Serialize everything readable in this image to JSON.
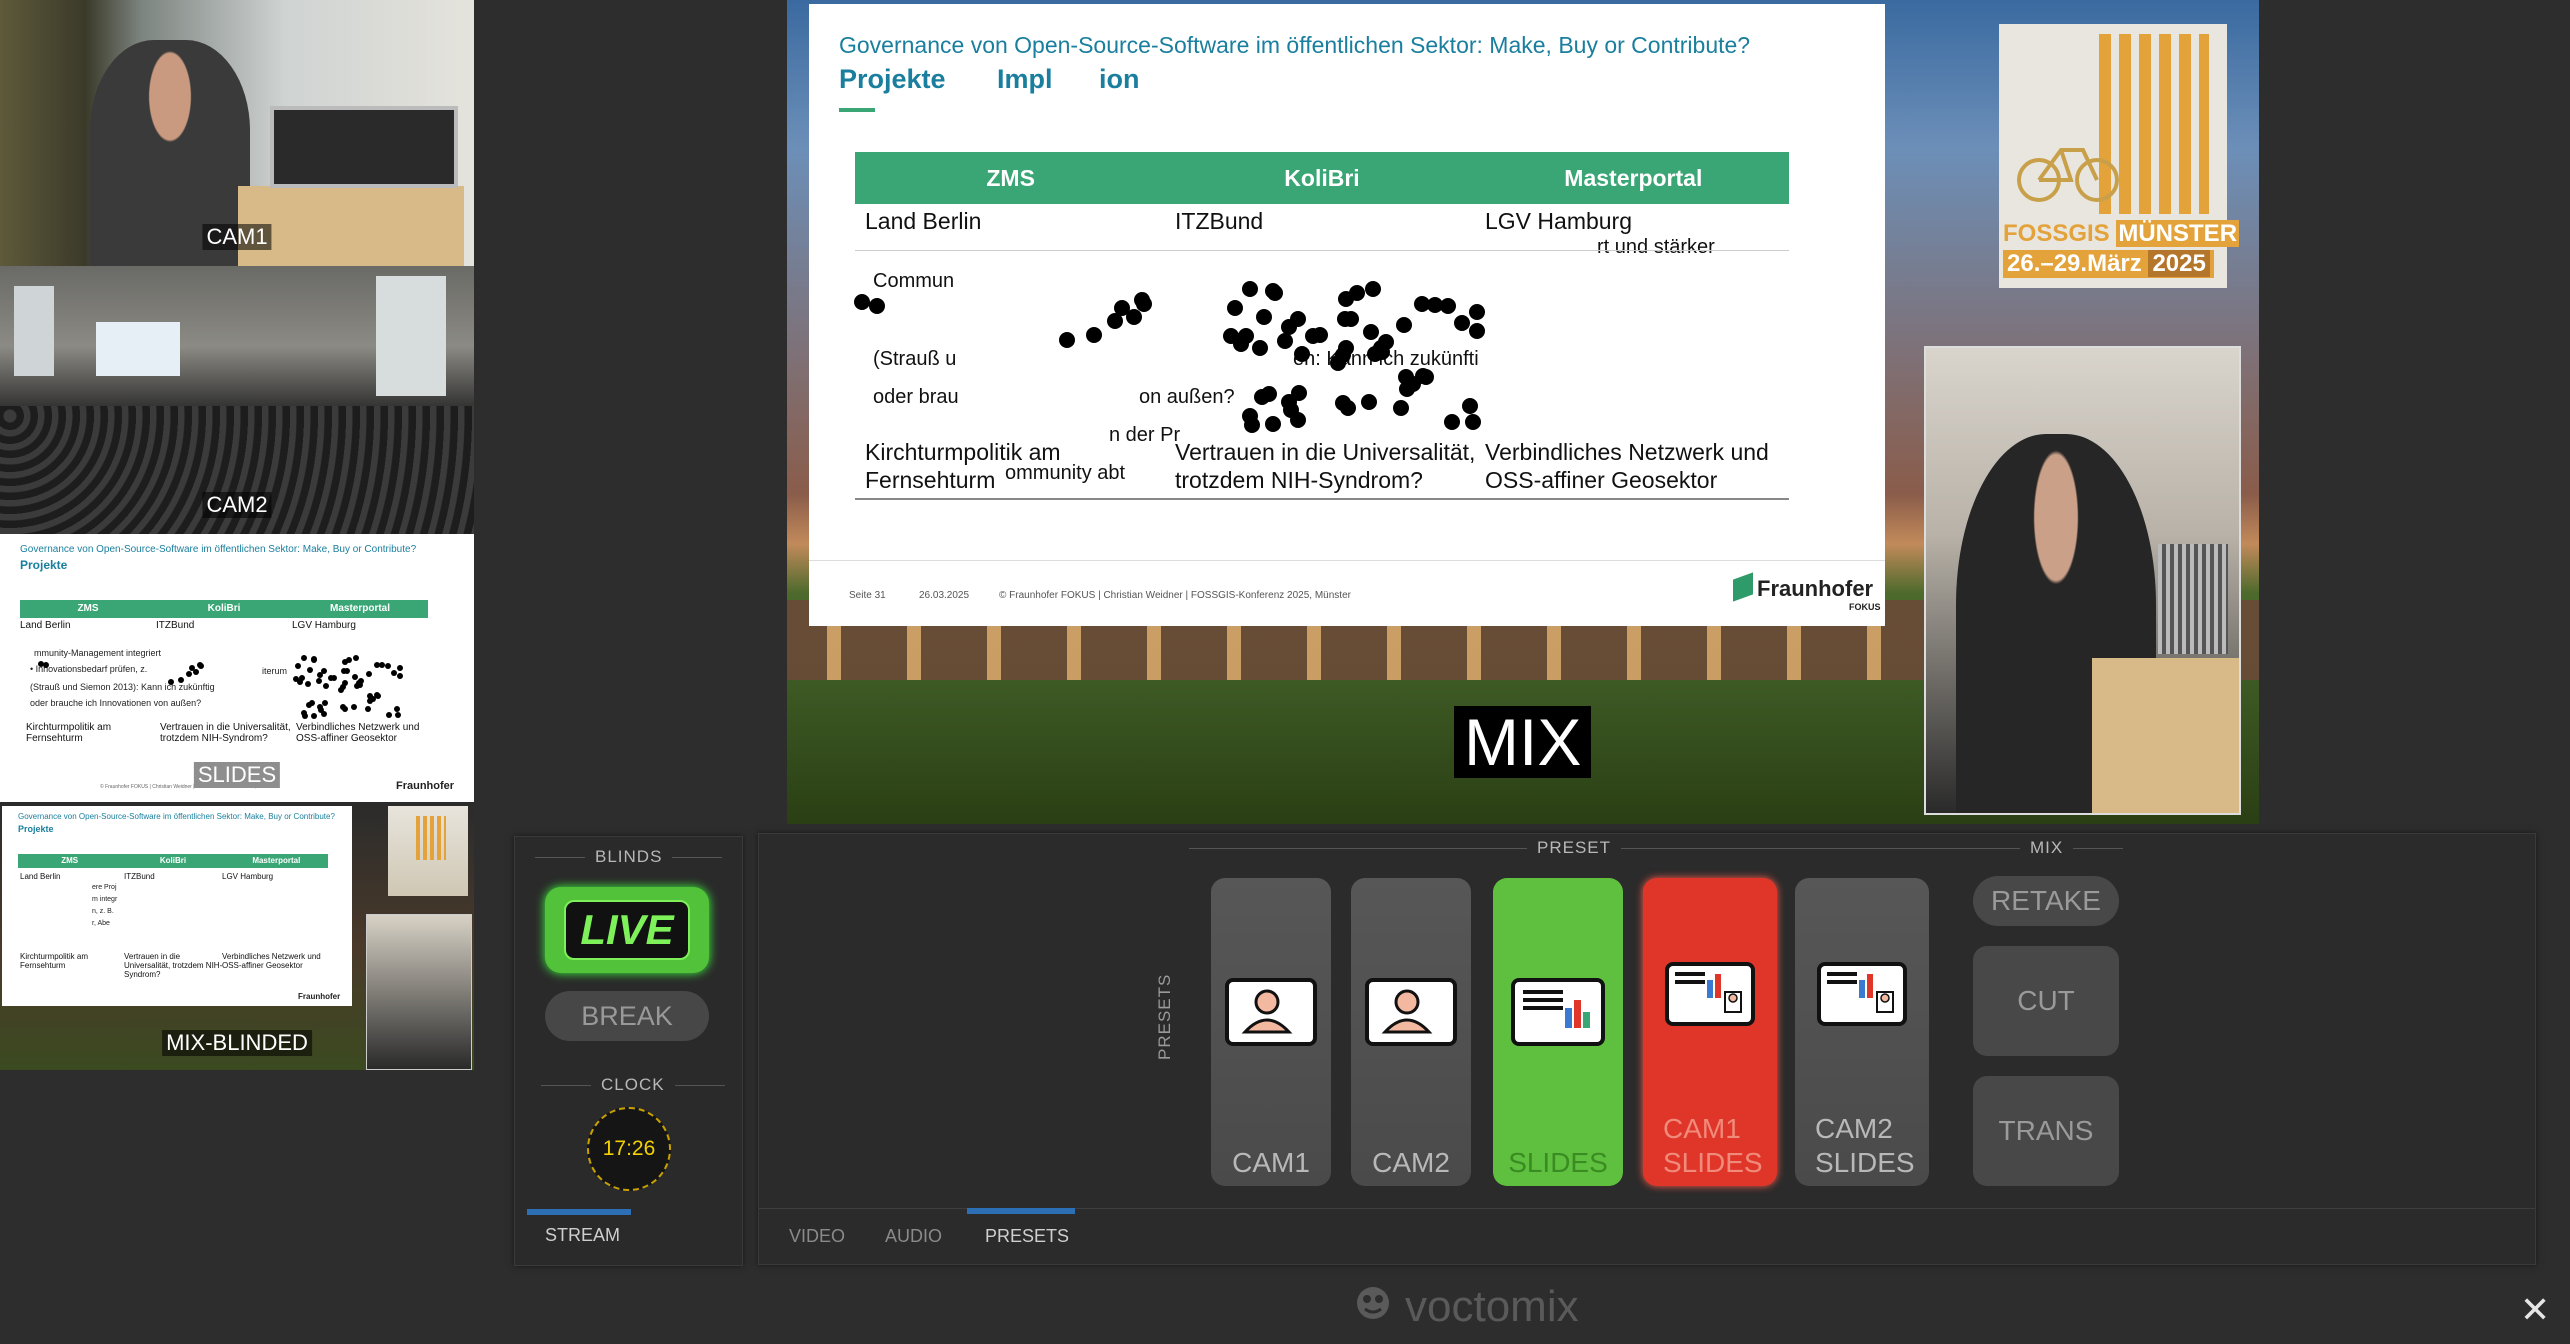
{
  "sources": [
    {
      "label": "CAM1"
    },
    {
      "label": "CAM2"
    },
    {
      "label": "SLIDES"
    },
    {
      "label": "MIX-BLINDED"
    }
  ],
  "slide": {
    "title": "Governance von Open-Source-Software im öffentlichen Sektor: Make, Buy or Contribute?",
    "heading": "Projekte",
    "heading_partial_1": "Impl",
    "heading_partial_2": "ion",
    "columns": [
      "ZMS",
      "KoliBri",
      "Masterportal"
    ],
    "row1": [
      "Land Berlin",
      "ITZBund",
      "LGV Hamburg"
    ],
    "row1_overlay": "rt und stärker",
    "text_commun": "Commun",
    "text_strauss": "(Strauß u",
    "text_kann": "en: Kann ich zukünfti",
    "text_oder": "oder brau",
    "text_von_aussen": "on außen?",
    "text_der_pr": "n der Pr",
    "text_abt": "ommunity abt",
    "row_last": [
      "Kirchturmpolitik am Fernsehturm",
      "Vertrauen in die Universalität, trotzdem NIH-Syndrom?",
      "Verbindliches Netzwerk und OSS-affiner Geosektor"
    ],
    "footer_page": "Seite 31",
    "footer_date": "26.03.2025",
    "footer_text": "© Fraunhofer FOKUS | Christian Weidner | FOSSGIS-Konferenz 2025, Münster",
    "brand": "Fraunhofer",
    "brand_sub": "FOKUS"
  },
  "mini_slide": {
    "row_comm": "mmunity-Management integriert",
    "row_innov": "• Innovationsbedarf prüfen, z.",
    "row_strauss": "(Strauß und Siemon 2013): Kann ich zukünftig",
    "row_oder": "oder brauche ich Innovationen von außen?",
    "col_right_partial": "iterum"
  },
  "mini_mix": {
    "partial_1": "ere Proj",
    "partial_2": "m integr",
    "partial_3": "n, z. B.",
    "partial_3b": "r, Abe"
  },
  "program": {
    "label": "MIX"
  },
  "event_logo": {
    "name": "FOSSGIS",
    "city": "MÜNSTER",
    "dates": "26.–29.März",
    "year": "2025"
  },
  "blinds": {
    "section": "BLINDS",
    "live": "LIVE",
    "break": "BREAK",
    "clock_section": "CLOCK",
    "clock_time": "17:26",
    "tab": "STREAM"
  },
  "presets": {
    "section": "PRESET",
    "vertical_label": "PRESETS",
    "tiles": [
      {
        "label": "CAM1",
        "state": "normal"
      },
      {
        "label": "CAM2",
        "state": "normal"
      },
      {
        "label": "SLIDES",
        "state": "preview"
      },
      {
        "label": "CAM1 SLIDES",
        "state": "program"
      },
      {
        "label": "CAM2 SLIDES",
        "state": "normal"
      }
    ]
  },
  "mix": {
    "section": "MIX",
    "retake": "RETAKE",
    "cut": "CUT",
    "trans": "TRANS"
  },
  "tabs": [
    "VIDEO",
    "AUDIO",
    "PRESETS"
  ],
  "app": {
    "name": "voctomix",
    "close": "✕"
  },
  "colors": {
    "preview": "#5ec03e",
    "program": "#e0362a",
    "accent": "#2c6fb4",
    "live": "#7df05a"
  }
}
